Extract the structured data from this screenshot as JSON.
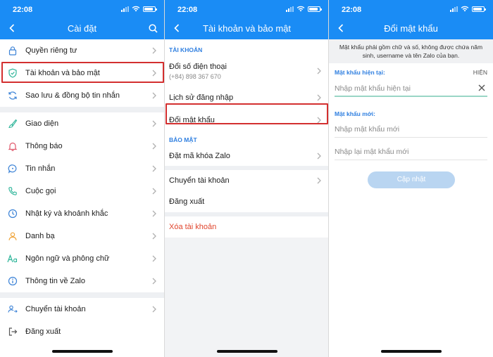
{
  "status_time": "22:08",
  "colors": {
    "header": "#1a8cf5",
    "section": "#2f7fe0",
    "danger": "#e0452d",
    "highlight": "#d32f2f"
  },
  "screen1": {
    "title": "Cài đặt",
    "items": [
      {
        "label": "Quyền riêng tư",
        "icon": "lock-icon"
      },
      {
        "label": "Tài khoản và bảo mật",
        "icon": "shield-icon"
      },
      {
        "label": "Sao lưu & đồng bộ tin nhắn",
        "icon": "sync-icon"
      },
      {
        "label": "Giao diện",
        "icon": "brush-icon"
      },
      {
        "label": "Thông báo",
        "icon": "bell-icon"
      },
      {
        "label": "Tin nhắn",
        "icon": "chat-icon"
      },
      {
        "label": "Cuộc gọi",
        "icon": "phone-icon"
      },
      {
        "label": "Nhật ký và khoảnh khắc",
        "icon": "clock-icon"
      },
      {
        "label": "Danh bạ",
        "icon": "contact-icon"
      },
      {
        "label": "Ngôn ngữ và phông chữ",
        "icon": "font-icon"
      },
      {
        "label": "Thông tin về Zalo",
        "icon": "info-icon"
      },
      {
        "label": "Chuyển tài khoản",
        "icon": "switch-account-icon"
      },
      {
        "label": "Đăng xuất",
        "icon": "logout-icon"
      }
    ]
  },
  "screen2": {
    "title": "Tài khoản và bảo mật",
    "section_account": "TÀI KHOẢN",
    "change_phone": "Đổi số điện thoại",
    "phone_number": "(+84) 898 367 670",
    "login_history": "Lịch sử đăng nhập",
    "change_password": "Đổi mật khẩu",
    "section_security": "BẢO MẬT",
    "set_lock": "Đặt mã khóa Zalo",
    "switch_account": "Chuyển tài khoản",
    "logout": "Đăng xuất",
    "delete_account": "Xóa tài khoản"
  },
  "screen3": {
    "title": "Đổi mật khẩu",
    "note": "Mật khẩu phải gồm chữ và số, không được chứa năm sinh, username và tên Zalo của bạn.",
    "current_label": "Mật khẩu hiện tại:",
    "show_label": "HIỆN",
    "current_placeholder": "Nhập mật khẩu hiện tại",
    "new_label": "Mật khẩu mới:",
    "new_placeholder": "Nhập mật khẩu mới",
    "confirm_placeholder": "Nhập lại mật khẩu mới",
    "submit_label": "Cập nhật"
  }
}
